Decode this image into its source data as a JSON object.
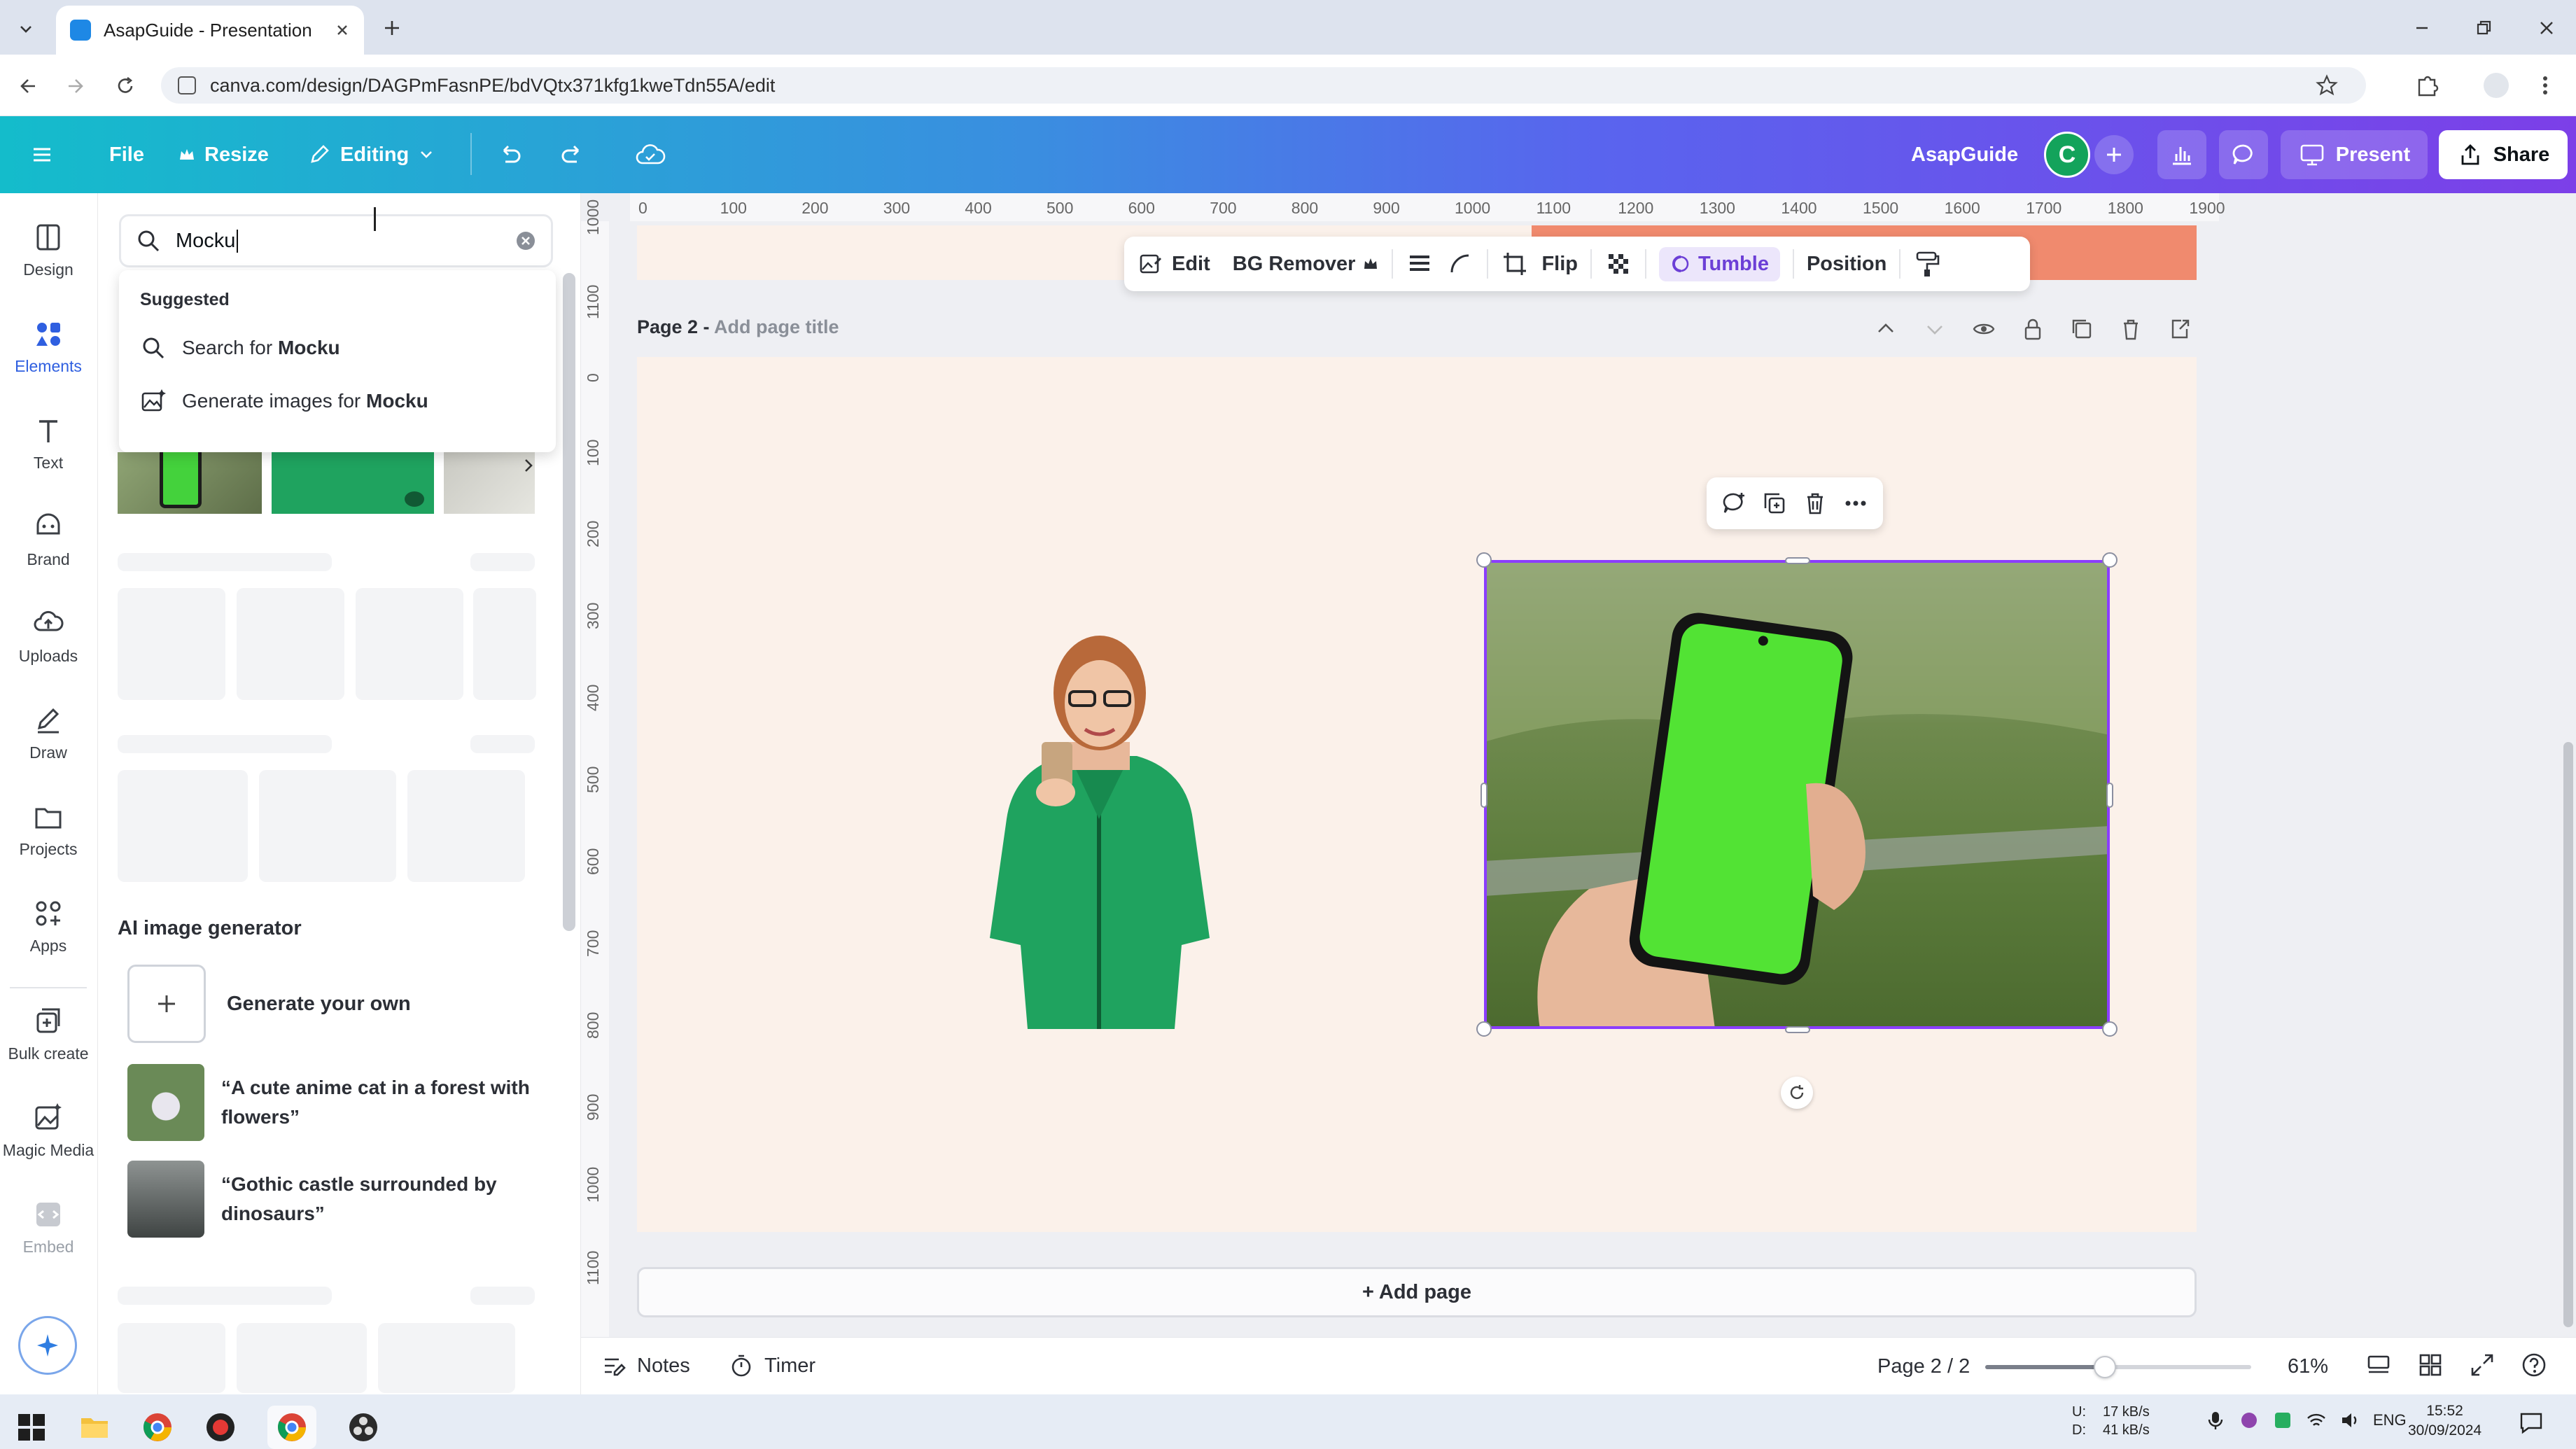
{
  "browser": {
    "tab_title": "AsapGuide - Presentation",
    "url": "canva.com/design/DAGPmFasnPE/bdVQtx371kfg1kweTdn55A/edit"
  },
  "topbar": {
    "file": "File",
    "resize": "Resize",
    "editing": "Editing",
    "brand": "AsapGuide",
    "avatar_letter": "C",
    "present": "Present",
    "share": "Share"
  },
  "rail": [
    {
      "label": "Design",
      "icon": "design-icon"
    },
    {
      "label": "Elements",
      "icon": "elements-icon"
    },
    {
      "label": "Text",
      "icon": "text-icon"
    },
    {
      "label": "Brand",
      "icon": "brand-icon"
    },
    {
      "label": "Uploads",
      "icon": "uploads-icon"
    },
    {
      "label": "Draw",
      "icon": "draw-icon"
    },
    {
      "label": "Projects",
      "icon": "projects-icon"
    },
    {
      "label": "Apps",
      "icon": "apps-icon"
    },
    {
      "label": "Bulk create",
      "icon": "bulk-create-icon"
    },
    {
      "label": "Magic Media",
      "icon": "magic-media-icon"
    },
    {
      "label": "Embed",
      "icon": "embed-icon"
    }
  ],
  "panel": {
    "search_value": "Mocku",
    "suggested_label": "Suggested",
    "suggest_search_prefix": "Search for ",
    "suggest_generate_prefix": "Generate images for ",
    "suggest_term": "Mocku",
    "ai_heading": "AI image generator",
    "generate_own": "Generate your own",
    "prompt1": "“A cute anime cat in a forest with flowers”",
    "prompt2": "“Gothic castle surrounded by dinosaurs”"
  },
  "toolbar": {
    "edit": "Edit",
    "bg_remover": "BG Remover",
    "flip": "Flip",
    "tumble": "Tumble",
    "position": "Position"
  },
  "canvas": {
    "page_label": "Page 2 - ",
    "page_title_placeholder": "Add page title",
    "add_page": "+ Add page",
    "ruler_top": [
      "0",
      "100",
      "200",
      "300",
      "400",
      "500",
      "600",
      "700",
      "800",
      "900",
      "1000",
      "1100",
      "1200",
      "1300",
      "1400",
      "1500",
      "1600",
      "1700",
      "1800",
      "1900"
    ],
    "ruler_left": [
      "1000",
      "1100",
      "0",
      "100",
      "200",
      "300",
      "400",
      "500",
      "600",
      "700",
      "800",
      "900",
      "1000",
      "1100"
    ]
  },
  "bottombar": {
    "notes": "Notes",
    "timer": "Timer",
    "page_count": "Page 2 / 2",
    "zoom": "61%",
    "zoom_fraction": 0.45
  },
  "taskbar": {
    "net_up_label": "U:",
    "net_down_label": "D:",
    "net_up": "17 kB/s",
    "net_down": "41 kB/s",
    "lang": "ENG",
    "time": "15:52",
    "date": "30/09/2024"
  }
}
